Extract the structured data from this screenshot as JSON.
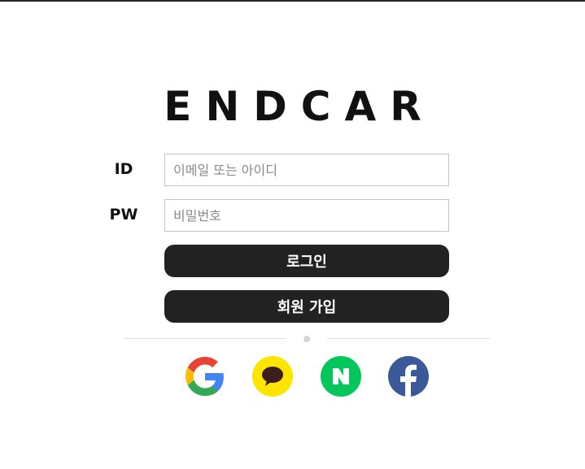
{
  "brand": {
    "logo_text": "ENDCAR"
  },
  "form": {
    "id_label": "ID",
    "id_placeholder": "이메일 또는 아이디",
    "pw_label": "PW",
    "pw_placeholder": "비밀번호"
  },
  "buttons": {
    "login_label": "로그인",
    "signup_label": "회원 가입"
  },
  "social_login": [
    {
      "provider": "Google",
      "icon": "google-icon",
      "color": "#4285f4"
    },
    {
      "provider": "Kakao",
      "icon": "kakao-icon",
      "color": "#fee500"
    },
    {
      "provider": "Naver",
      "icon": "naver-icon",
      "color": "#03c75a"
    },
    {
      "provider": "Facebook",
      "icon": "facebook-icon",
      "color": "#3b5998"
    }
  ],
  "colors": {
    "primary_button": "#222222",
    "button_text": "#ffffff"
  }
}
